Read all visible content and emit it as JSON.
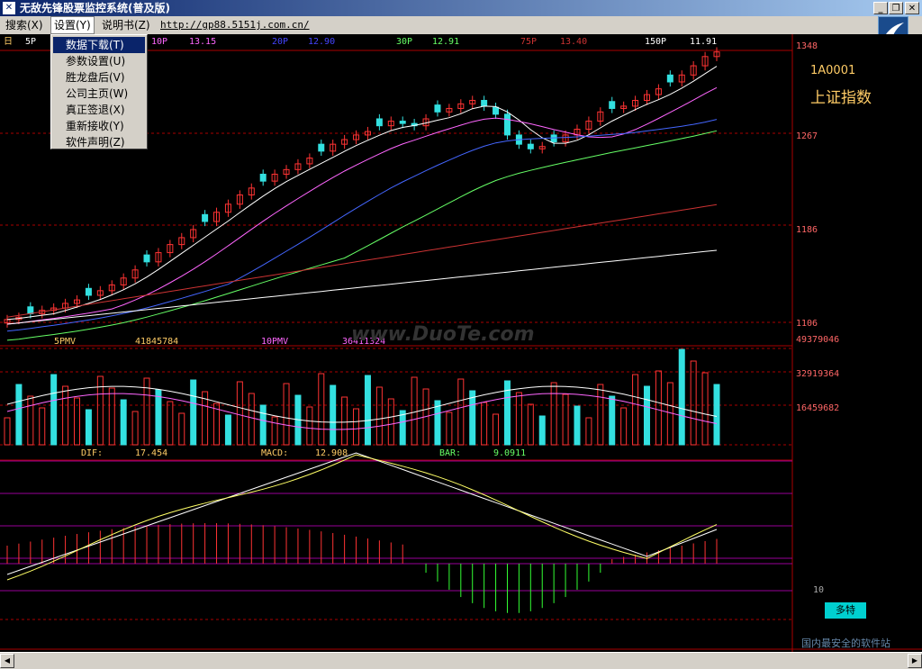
{
  "window": {
    "title": "无敌先锋股票监控系统(普及版)",
    "min_label": "_",
    "max_label": "❐",
    "close_label": "✕"
  },
  "menu": {
    "items": [
      {
        "label": "搜索(X)"
      },
      {
        "label": "设置(Y)"
      },
      {
        "label": "说明书(Z)"
      }
    ],
    "url": "http://gp88.5151j.com.cn/"
  },
  "dropdown": {
    "items": [
      {
        "label": "数据下载(T)",
        "selected": true
      },
      {
        "label": "参数设置(U)"
      },
      {
        "label": "胜龙盘后(V)"
      },
      {
        "label": "公司主页(W)"
      },
      {
        "label": "真正签退(X)"
      },
      {
        "label": "重新接收(Y)"
      },
      {
        "label": "软件声明(Z)"
      }
    ]
  },
  "stock": {
    "code": "1A0001",
    "name": "上证指数"
  },
  "price_panel": {
    "period_label": "日",
    "ma_labels": [
      {
        "name": "5P",
        "value": "",
        "color": "#ffffff"
      },
      {
        "name": "10P",
        "value": "13.15",
        "color": "#ff66ff"
      },
      {
        "name": "20P",
        "value": "12.90",
        "color": "#4444ff"
      },
      {
        "name": "30P",
        "value": "12.91",
        "color": "#66ff66"
      },
      {
        "name": "75P",
        "value": "13.40",
        "color": "#cc3333"
      },
      {
        "name": "150P",
        "value": "11.91",
        "color": "#ffffff"
      }
    ],
    "y_ticks": [
      "1348",
      "1267",
      "1186",
      "1106"
    ]
  },
  "volume_panel": {
    "labels": [
      {
        "name": "5PMV",
        "value": "41845784"
      },
      {
        "name": "10PMV",
        "value": "36411324"
      }
    ],
    "y_ticks": [
      "49379046",
      "32919364",
      "16459682"
    ]
  },
  "macd_panel": {
    "labels": [
      {
        "name": "DIF:",
        "value": "17.454"
      },
      {
        "name": "MACD:",
        "value": "12.908"
      },
      {
        "name": "BAR:",
        "value": "9.0911"
      }
    ],
    "corner_tick": "10"
  },
  "watermarks": {
    "center": "www.DuoTe.com",
    "badge": "多特",
    "bottom": "国内最安全的软件站"
  },
  "colors": {
    "up": "#ff3333",
    "down": "#33e0e0",
    "grid": "#aa0000",
    "axis_text": "#ff6666"
  },
  "chart_data": {
    "type": "candlestick",
    "close_index_approx": [
      1110,
      1112,
      1115,
      1118,
      1120,
      1124,
      1127,
      1131,
      1135,
      1140,
      1146,
      1153,
      1160,
      1168,
      1175,
      1181,
      1188,
      1195,
      1203,
      1210,
      1218,
      1224,
      1230,
      1236,
      1240,
      1245,
      1250,
      1256,
      1262,
      1266,
      1270,
      1273,
      1278,
      1282,
      1280,
      1278,
      1284,
      1290,
      1293,
      1297,
      1300,
      1295,
      1288,
      1270,
      1262,
      1258,
      1260,
      1264,
      1270,
      1275,
      1282,
      1290,
      1293,
      1295,
      1300,
      1305,
      1310,
      1316,
      1322,
      1330,
      1338,
      1342
    ]
  }
}
